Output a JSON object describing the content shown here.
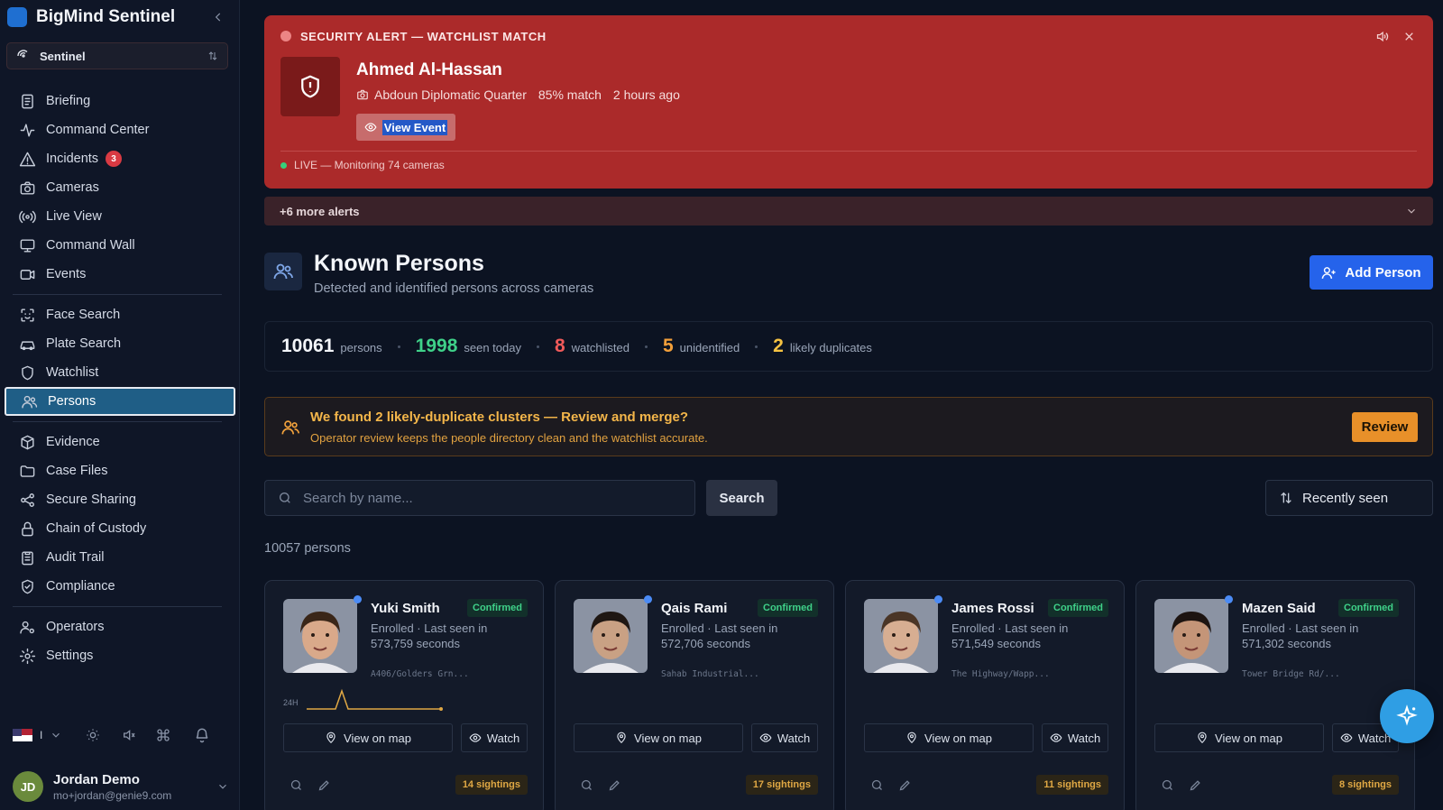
{
  "app": {
    "title": "BigMind Sentinel",
    "workspace": "Sentinel"
  },
  "nav": {
    "group1": [
      {
        "label": "Briefing",
        "icon": "briefing-icon"
      },
      {
        "label": "Command Center",
        "icon": "activity-icon"
      },
      {
        "label": "Incidents",
        "icon": "warning-icon",
        "badge": "3"
      },
      {
        "label": "Cameras",
        "icon": "camera-icon"
      },
      {
        "label": "Live View",
        "icon": "broadcast-icon"
      },
      {
        "label": "Command Wall",
        "icon": "monitor-icon"
      },
      {
        "label": "Events",
        "icon": "video-icon"
      }
    ],
    "group2": [
      {
        "label": "Face Search",
        "icon": "face-scan-icon"
      },
      {
        "label": "Plate Search",
        "icon": "car-icon"
      },
      {
        "label": "Watchlist",
        "icon": "shield-icon"
      },
      {
        "label": "Persons",
        "icon": "users-icon",
        "active": true
      }
    ],
    "group3": [
      {
        "label": "Evidence",
        "icon": "box-icon"
      },
      {
        "label": "Case Files",
        "icon": "folder-icon"
      },
      {
        "label": "Secure Sharing",
        "icon": "share-icon"
      },
      {
        "label": "Chain of Custody",
        "icon": "lock-icon"
      },
      {
        "label": "Audit Trail",
        "icon": "clipboard-icon"
      },
      {
        "label": "Compliance",
        "icon": "shield-check-icon"
      }
    ],
    "group4": [
      {
        "label": "Operators",
        "icon": "user-gear-icon"
      },
      {
        "label": "Settings",
        "icon": "gear-icon"
      }
    ]
  },
  "footer": {
    "language": "I"
  },
  "user": {
    "initials": "JD",
    "name": "Jordan Demo",
    "email": "mo+jordan@genie9.com"
  },
  "alert": {
    "title": "SECURITY ALERT — WATCHLIST MATCH",
    "name": "Ahmed Al-Hassan",
    "location": "Abdoun Diplomatic Quarter",
    "match": "85% match",
    "time": "2 hours ago",
    "view_label": "View Event",
    "live": "LIVE — Monitoring 74 cameras",
    "more": "+6 more alerts",
    "color": "#ab2a2a"
  },
  "header": {
    "title": "Known Persons",
    "subtitle": "Detected and identified persons across cameras",
    "add_label": "Add Person"
  },
  "stats": [
    {
      "value": "10061",
      "label": "persons",
      "color": "#f3f5f9"
    },
    {
      "value": "1998",
      "label": "seen today",
      "color": "#3fd189"
    },
    {
      "value": "8",
      "label": "watchlisted",
      "color": "#f05a5a"
    },
    {
      "value": "5",
      "label": "unidentified",
      "color": "#f29f3a"
    },
    {
      "value": "2",
      "label": "likely duplicates",
      "color": "#f5c242"
    }
  ],
  "duplicates": {
    "title": "We found 2 likely-duplicate clusters — Review and merge?",
    "text": "Operator review keeps the people directory clean and the watchlist accurate.",
    "review_label": "Review"
  },
  "search": {
    "placeholder": "Search by name...",
    "button": "Search",
    "sort": "Recently seen"
  },
  "count": "10057 persons",
  "cards": [
    {
      "name": "Yuki Smith",
      "status": "Confirmed",
      "info": "Enrolled · Last seen in 573,759 seconds",
      "addr": "A406/Golders Grn...",
      "sightings": "14 sightings",
      "spark": "24H",
      "skin": "#d9a98a",
      "hair": "#3a2618"
    },
    {
      "name": "Qais Rami",
      "status": "Confirmed",
      "info": "Enrolled · Last seen in 572,706 seconds",
      "addr": "Sahab Industrial...",
      "sightings": "17 sightings",
      "skin": "#c9a184",
      "hair": "#1f1713"
    },
    {
      "name": "James Rossi",
      "status": "Confirmed",
      "info": "Enrolled · Last seen in 571,549 seconds",
      "addr": "The Highway/Wapp...",
      "sightings": "11 sightings",
      "skin": "#d7ae92",
      "hair": "#4a3526"
    },
    {
      "name": "Mazen Said",
      "status": "Confirmed",
      "info": "Enrolled · Last seen in 571,302 seconds",
      "addr": "Tower Bridge Rd/...",
      "sightings": "8 sightings",
      "skin": "#c49578",
      "hair": "#1d1411"
    }
  ],
  "card_actions": {
    "map": "View on map",
    "watch": "Watch"
  }
}
